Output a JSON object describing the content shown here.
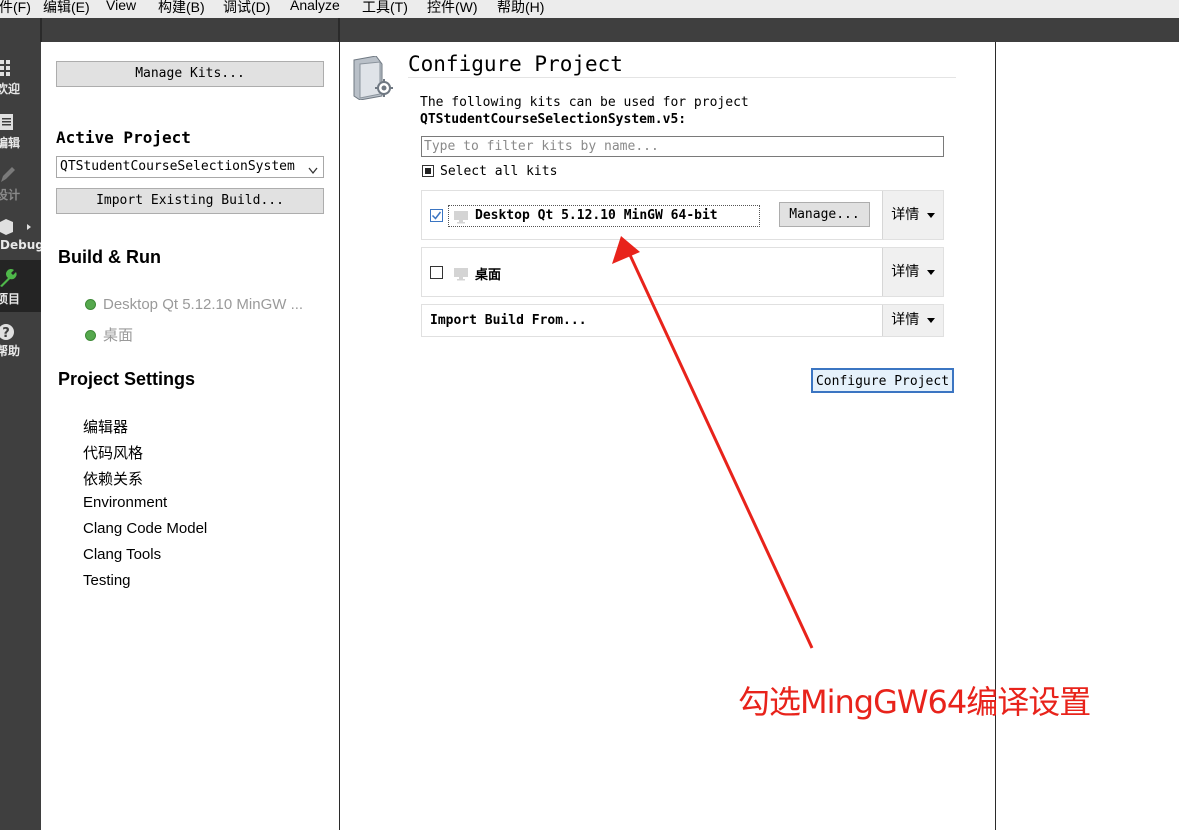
{
  "menubar": {
    "items": [
      {
        "label": "件(F)"
      },
      {
        "label": "编辑(E)"
      },
      {
        "label": "View"
      },
      {
        "label": "构建(B)"
      },
      {
        "label": "调试(D)"
      },
      {
        "label": "Analyze"
      },
      {
        "label": "工具(T)"
      },
      {
        "label": "控件(W)"
      },
      {
        "label": "帮助(H)"
      }
    ]
  },
  "modebar": {
    "items": [
      {
        "label": "欢迎",
        "icon": "grid-icon"
      },
      {
        "label": "编辑",
        "icon": "document-icon"
      },
      {
        "label": "设计",
        "icon": "pencil-icon"
      },
      {
        "label": "Debug",
        "icon": "bug-icon"
      },
      {
        "label": "项目",
        "icon": "wrench-icon",
        "active": true
      },
      {
        "label": "帮助",
        "icon": "help-icon"
      }
    ]
  },
  "sidebar": {
    "manage_kits_label": "Manage Kits...",
    "active_project_heading": "Active Project",
    "active_project_value": "QTStudentCourseSelectionSystem",
    "import_build_label": "Import Existing Build...",
    "build_run_heading": "Build & Run",
    "build_run_items": [
      "Desktop Qt 5.12.10 MinGW ...",
      "桌面"
    ],
    "project_settings_heading": "Project Settings",
    "project_settings_items": [
      "编辑器",
      "代码风格",
      "依赖关系",
      "Environment",
      "Clang Code Model",
      "Clang Tools",
      "Testing"
    ]
  },
  "main": {
    "title": "Configure Project",
    "description_line1": "The following kits can be used for project",
    "description_project": "QTStudentCourseSelectionSystem.v5:",
    "filter_placeholder": "Type to filter kits by name...",
    "select_all_label": "Select all kits",
    "kits": [
      {
        "name": "Desktop Qt 5.12.10 MinGW 64-bit",
        "checked": true,
        "manage_label": "Manage...",
        "details_label": "详情"
      },
      {
        "name": "桌面",
        "checked": false,
        "details_label": "详情"
      }
    ],
    "import_build_from_label": "Import Build From...",
    "import_details_label": "详情",
    "configure_button_label": "Configure Project"
  },
  "annotation": {
    "text": "勾选MingGW64编译设置",
    "color": "#e8231b"
  },
  "colors": {
    "modebar_bg": "#3f3f3f",
    "accent_blue": "#3b75c2",
    "annotation_red": "#e8231b"
  }
}
